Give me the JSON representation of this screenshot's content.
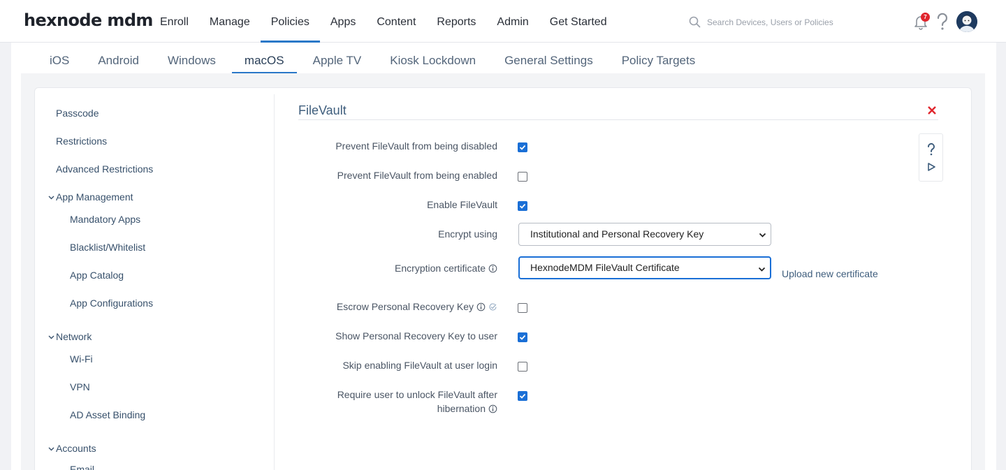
{
  "brand": {
    "logo": "hexnode mdm"
  },
  "main_nav": [
    "Enroll",
    "Manage",
    "Policies",
    "Apps",
    "Content",
    "Reports",
    "Admin",
    "Get Started"
  ],
  "main_nav_active": "Policies",
  "search": {
    "placeholder": "Search Devices, Users or Policies"
  },
  "notifications": {
    "count": "7"
  },
  "sub_nav": [
    "iOS",
    "Android",
    "Windows",
    "macOS",
    "Apple TV",
    "Kiosk Lockdown",
    "General Settings",
    "Policy Targets"
  ],
  "sub_nav_active": "macOS",
  "sidebar": {
    "passcode": "Passcode",
    "restrictions": "Restrictions",
    "advanced_restrictions": "Advanced Restrictions",
    "app_management": "App Management",
    "mandatory_apps": "Mandatory Apps",
    "blacklist_whitelist": "Blacklist/Whitelist",
    "app_catalog": "App Catalog",
    "app_configurations": "App Configurations",
    "network": "Network",
    "wifi": "Wi-Fi",
    "vpn": "VPN",
    "ad_asset_binding": "AD Asset Binding",
    "accounts": "Accounts",
    "email": "Email"
  },
  "form": {
    "title": "FileVault",
    "prevent_disabled": {
      "label": "Prevent FileVault from being disabled",
      "checked": true
    },
    "prevent_enabled": {
      "label": "Prevent FileVault from being enabled",
      "checked": false
    },
    "enable": {
      "label": "Enable FileVault",
      "checked": true
    },
    "encrypt_using": {
      "label": "Encrypt using",
      "value": "Institutional and Personal Recovery Key"
    },
    "encryption_certificate": {
      "label": "Encryption certificate",
      "value": "HexnodeMDM FileVault Certificate"
    },
    "upload_link": "Upload new certificate",
    "escrow": {
      "label": "Escrow Personal Recovery Key",
      "checked": false
    },
    "show_key": {
      "label": "Show Personal Recovery Key to user",
      "checked": true
    },
    "skip_login": {
      "label": "Skip enabling FileVault at user login",
      "checked": false
    },
    "require_unlock": {
      "label_line1": "Require user to unlock FileVault after",
      "label_line2": "hibernation",
      "checked": true
    }
  },
  "colors": {
    "accent": "#1a6fd6",
    "close": "#e0252d",
    "badge": "#e0252d"
  },
  "icons": [
    "search-icon",
    "bell-icon",
    "help-icon",
    "avatar",
    "close-icon",
    "info-icon",
    "check-circle-icon",
    "play-icon",
    "chevron-down-icon"
  ]
}
